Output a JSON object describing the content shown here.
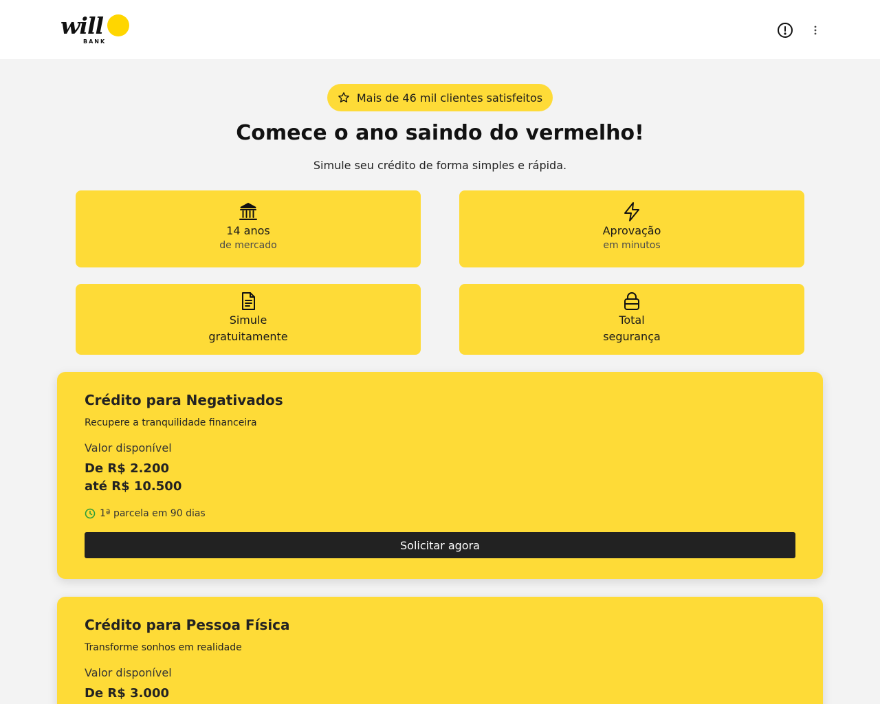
{
  "header": {
    "logo_word": "will",
    "logo_sub": "BANK",
    "logo_dot_color": "#ffd600",
    "alert_icon": "alert-circle-icon",
    "menu_icon": "more-vertical-icon"
  },
  "hero": {
    "badge_icon": "star-icon",
    "badge_text": "Mais de 46 mil clientes satisfeitos",
    "title": "Comece o ano saindo do vermelho!",
    "subtitle": "Simule seu crédito de forma simples e rápida."
  },
  "features": [
    {
      "icon": "bank-icon",
      "main": "14 anos",
      "sub": "de mercado"
    },
    {
      "icon": "lightning-icon",
      "main": "Aprovação",
      "sub": "em minutos"
    },
    {
      "icon": "document-icon",
      "line1": "Simule",
      "line2": "gratuitamente"
    },
    {
      "icon": "lock-icon",
      "line1": "Total",
      "line2": "segurança"
    }
  ],
  "cards": [
    {
      "title": "Crédito para Negativados",
      "description": "Recupere a tranquilidade financeira",
      "label": "Valor disponível",
      "amount_from": "De R$ 2.200",
      "amount_to": "até R$ 10.500",
      "note_icon": "clock-icon",
      "note": "1ª parcela em 90 dias",
      "cta": "Solicitar agora"
    },
    {
      "title": "Crédito para Pessoa Física",
      "description": "Transforme sonhos em realidade",
      "label": "Valor disponível",
      "amount_from": "De R$ 3.000"
    }
  ],
  "colors": {
    "accent_yellow": "#fedb37",
    "page_background": "#f3f3f3",
    "button_dark": "#222222",
    "note_icon_green": "#2e9e3a"
  }
}
